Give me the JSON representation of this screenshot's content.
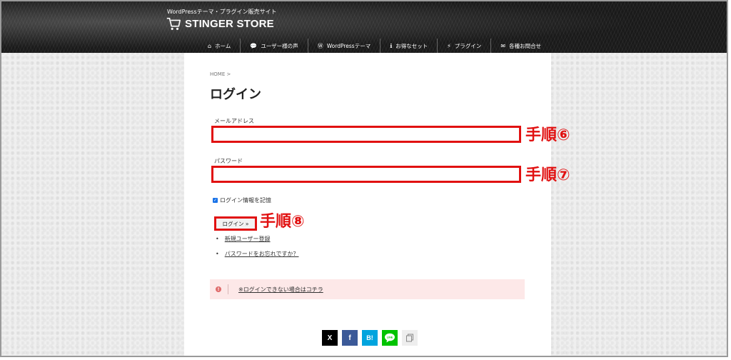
{
  "header": {
    "tagline": "WordPressテーマ・プラグイン販売サイト",
    "logo": "STINGER STORE",
    "nav": [
      {
        "icon": "home-icon",
        "glyph": "⌂",
        "label": "ホーム"
      },
      {
        "icon": "comment-icon",
        "glyph": "💬",
        "label": "ユーザー様の声"
      },
      {
        "icon": "wordpress-icon",
        "glyph": "Ⓦ",
        "label": "WordPressテーマ"
      },
      {
        "icon": "info-icon",
        "glyph": "ℹ",
        "label": "お得なセット"
      },
      {
        "icon": "plug-icon",
        "glyph": "⚡",
        "label": "プラグイン"
      },
      {
        "icon": "mail-icon",
        "glyph": "✉",
        "label": "各種お問合せ"
      }
    ]
  },
  "breadcrumb": "HOME >",
  "page_title": "ログイン",
  "form": {
    "email_label": "メールアドレス",
    "email_value": "",
    "password_label": "パスワード",
    "password_value": "",
    "remember_label": "ログイン情報を記憶",
    "remember_checked": true,
    "login_button": "ログイン »",
    "links": [
      "新規ユーザー登録",
      "パスワードをお忘れですか？"
    ]
  },
  "annotations": {
    "step6": "手順⑥",
    "step7": "手順⑦",
    "step8": "手順⑧",
    "color": "#e11111"
  },
  "alert": {
    "text": "※ログインできない場合はコチラ",
    "icon": "exclamation-icon"
  },
  "share": [
    {
      "name": "x-share-button",
      "label": "X",
      "color": "#000000"
    },
    {
      "name": "facebook-share-button",
      "label": "f",
      "color": "#3b5998"
    },
    {
      "name": "hatena-share-button",
      "label": "B!",
      "color": "#00a4de"
    },
    {
      "name": "line-share-button",
      "label": "LINE",
      "color": "#00c300"
    },
    {
      "name": "copy-link-button",
      "label": "copy",
      "color": "#eeeeee"
    }
  ]
}
